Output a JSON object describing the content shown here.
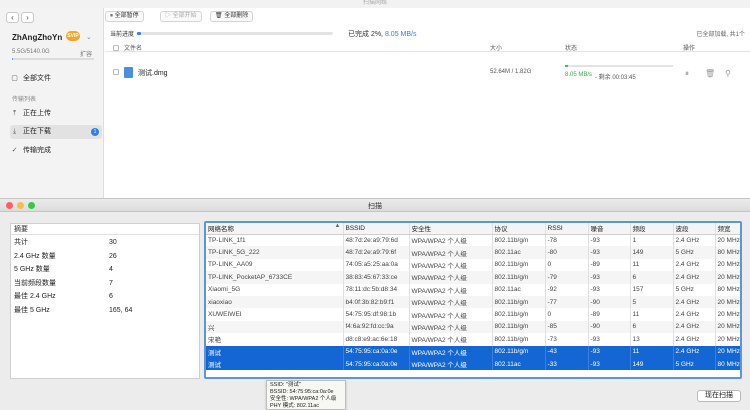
{
  "app": {
    "title": "扫描网络",
    "user": {
      "name": "ZhAngZhoYn",
      "vip": "SVIP",
      "storage": "5.5G/5140.0G",
      "expand": "扩容"
    },
    "storage_fraction": 0.001,
    "sidebar": {
      "all_files": "全部文件",
      "section_label": "传输列表",
      "uploading": "正在上传",
      "downloading": "正在下载",
      "downloading_count": "1",
      "completed": "传输完成"
    },
    "toolbar": {
      "pause_all": "全部暂停",
      "start_all": "全部开始",
      "delete_all": "全部删除"
    },
    "progress": {
      "label": "当前进度",
      "status": "已完成 2%,",
      "speed": "8.05 MB/s",
      "percent": 2,
      "loaded": "已全部加载, 共1个"
    },
    "file_header": {
      "name": "文件名",
      "size": "大小",
      "status": "状态",
      "actions": "操作"
    },
    "file": {
      "name": "测试.dmg",
      "size": "52.64M / 1.82G",
      "speed": "8.05 MB/s",
      "remaining": "- 剩余 00:03:45",
      "progress": 0.03
    }
  },
  "scan": {
    "title": "扫描",
    "summary": {
      "header": "摘要",
      "rows": [
        {
          "k": "共计",
          "v": "30"
        },
        {
          "k": "2.4 GHz 数量",
          "v": "26"
        },
        {
          "k": "5 GHz 数量",
          "v": "4"
        },
        {
          "k": "当前频段数量",
          "v": "7"
        },
        {
          "k": "最佳 2.4 GHz",
          "v": "6"
        },
        {
          "k": "最佳 5 GHz",
          "v": "165, 64"
        }
      ]
    },
    "table": {
      "columns": [
        "网络名称",
        "BSSID",
        "安全性",
        "协议",
        "RSSI",
        "噪音",
        "频段",
        "波段",
        "频宽"
      ],
      "rows": [
        [
          "TP-LINK_1f1",
          "48:7d:2e:a9:79:6d",
          "WPA/WPA2 个人级",
          "802.11b/g/n",
          "-78",
          "-93",
          "1",
          "2.4 GHz",
          "20 MHz"
        ],
        [
          "TP-LINK_5G_222",
          "48:7d:2e:a9:79:6f",
          "WPA/WPA2 个人级",
          "802.11ac",
          "-80",
          "-93",
          "149",
          "5 GHz",
          "80 MHz"
        ],
        [
          "TP-LINK_AA09",
          "74:05:a5:25:aa:0a",
          "WPA/WPA2 个人级",
          "802.11b/g/n",
          "0",
          "-89",
          "11",
          "2.4 GHz",
          "20 MHz"
        ],
        [
          "TP-LINK_PocketAP_6733CE",
          "38:83:45:67:33:ce",
          "WPA/WPA2 个人级",
          "802.11b/g/n",
          "-79",
          "-93",
          "6",
          "2.4 GHz",
          "20 MHz"
        ],
        [
          "Xiaomi_5G",
          "78:11:dc:5b:d8:34",
          "WPA/WPA2 个人级",
          "802.11ac",
          "-92",
          "-93",
          "157",
          "5 GHz",
          "80 MHz"
        ],
        [
          "xiaoxiao",
          "b4:0f:3b:82:b9:f1",
          "WPA/WPA2 个人级",
          "802.11b/g/n",
          "-77",
          "-90",
          "5",
          "2.4 GHz",
          "20 MHz"
        ],
        [
          "XUWEIWEI",
          "54:75:95:df:98:1b",
          "WPA/WPA2 个人级",
          "802.11b/g/n",
          "0",
          "-89",
          "11",
          "2.4 GHz",
          "20 MHz"
        ],
        [
          "兴",
          "f4:6a:92:fd:cc:9a",
          "WPA/WPA2 个人级",
          "802.11b/g/n",
          "-85",
          "-90",
          "6",
          "2.4 GHz",
          "20 MHz"
        ],
        [
          "宋艳",
          "d8:c8:e9:ac:6e:18",
          "WPA/WPA2 个人级",
          "802.11b/g/n",
          "-73",
          "-93",
          "13",
          "2.4 GHz",
          "20 MHz"
        ],
        [
          "测试",
          "54:75:95:ca:0a:0e",
          "WPA/WPA2 个人级",
          "802.11b/g/n",
          "-43",
          "-93",
          "11",
          "2.4 GHz",
          "20 MHz"
        ],
        [
          "测试",
          "54:75:95:ca:0a:0e",
          "WPA/WPA2 个人级",
          "802.11ac",
          "-33",
          "-93",
          "149",
          "5 GHz",
          "80 MHz"
        ]
      ],
      "selected": [
        9,
        10
      ]
    },
    "tooltip": {
      "ssid": "SSID: \"测试\"",
      "bssid": "BSSID: 54:75:95:ca:0a:0e",
      "security": "安全性: WPA/WPA2 个人级",
      "phy": "PHY 模式: 802.11ac"
    },
    "rescan": "现在扫描"
  },
  "colors": {
    "accent": "#2e7ef0",
    "selection": "#1366d3",
    "green": "#34c759"
  }
}
